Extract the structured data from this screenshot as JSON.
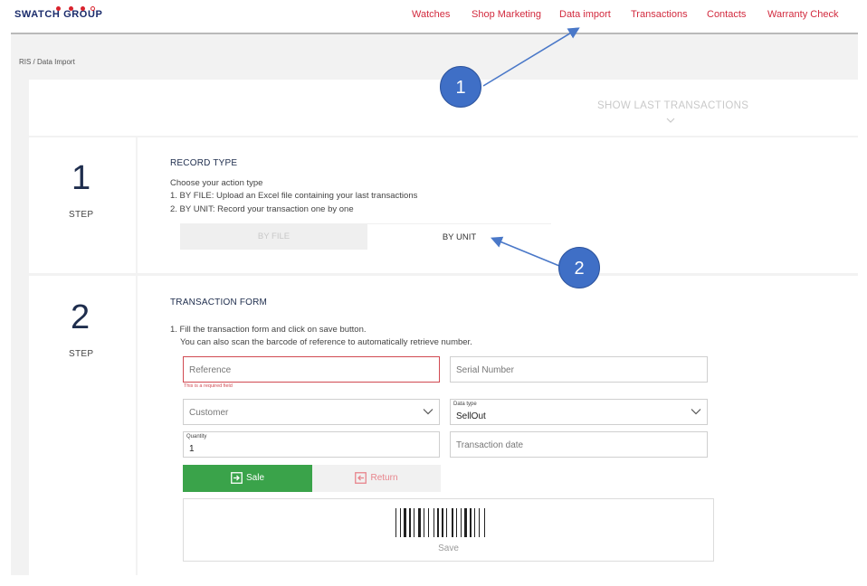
{
  "brand": {
    "logo_text": "SWATCH GROUP"
  },
  "nav": {
    "items": [
      "Watches",
      "Shop Marketing",
      "Data import",
      "Transactions",
      "Contacts",
      "Warranty Check"
    ]
  },
  "breadcrumb": "RIS /  Data Import",
  "show_last_transactions": "SHOW LAST TRANSACTIONS",
  "step1": {
    "number": "1",
    "label": "STEP",
    "title": "RECORD TYPE",
    "instructions": [
      "Choose your action type",
      "1. BY FILE: Upload an Excel file containing your last transactions",
      "2. BY UNIT: Record your transaction one by one"
    ],
    "option_file": "BY FILE",
    "option_unit": "BY UNIT",
    "selected": "BY UNIT"
  },
  "step2": {
    "number": "2",
    "label": "STEP",
    "title": "TRANSACTION FORM",
    "instructions": [
      "1. Fill the transaction form and click on save button.",
      "You can also scan the barcode of reference to automatically retrieve number."
    ],
    "reference_placeholder": "Reference",
    "reference_error": "This is a required field",
    "serial_placeholder": "Serial Number",
    "customer_placeholder": "Customer",
    "data_type_label": "Data type",
    "data_type_value": "SellOut",
    "quantity_label": "Quantity",
    "quantity_value": "1",
    "transaction_date_placeholder": "Transaction date",
    "sale_label": "Sale",
    "return_label": "Return",
    "save_label": "Save"
  },
  "callouts": [
    "1",
    "2"
  ],
  "colors": {
    "nav_red": "#d22a3e",
    "logo_blue": "#1a2b6b",
    "sale_green": "#3aa34a",
    "error_red": "#d14a52",
    "callout_blue": "#3f6fc6"
  }
}
